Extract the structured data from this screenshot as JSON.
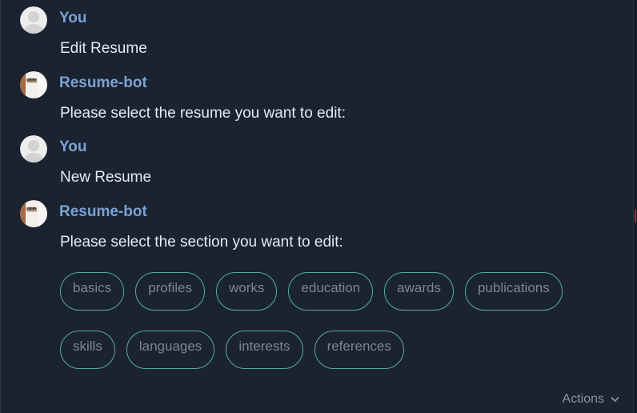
{
  "messages": [
    {
      "author": "You",
      "avatar": "default-user-avatar-icon",
      "text": "Edit Resume"
    },
    {
      "author": "Resume-bot",
      "avatar": "resume-bot-avatar",
      "text": "Please select the resume you want to edit:"
    },
    {
      "author": "You",
      "avatar": "default-user-avatar-icon",
      "text": "New Resume"
    },
    {
      "author": "Resume-bot",
      "avatar": "resume-bot-avatar",
      "text": "Please select the section you want to edit:"
    }
  ],
  "section_options": [
    [
      "basics",
      "profiles",
      "works",
      "education",
      "awards",
      "publications"
    ],
    [
      "skills",
      "languages",
      "interests",
      "references"
    ]
  ],
  "actions": {
    "label": "Actions",
    "icon": "chevron-down-icon"
  },
  "colors": {
    "background": "#1b2330",
    "author": "#7aa3d4",
    "message_text": "#e6eaf0",
    "chip_border": "#56aaa0",
    "chip_text": "#7d8590"
  }
}
